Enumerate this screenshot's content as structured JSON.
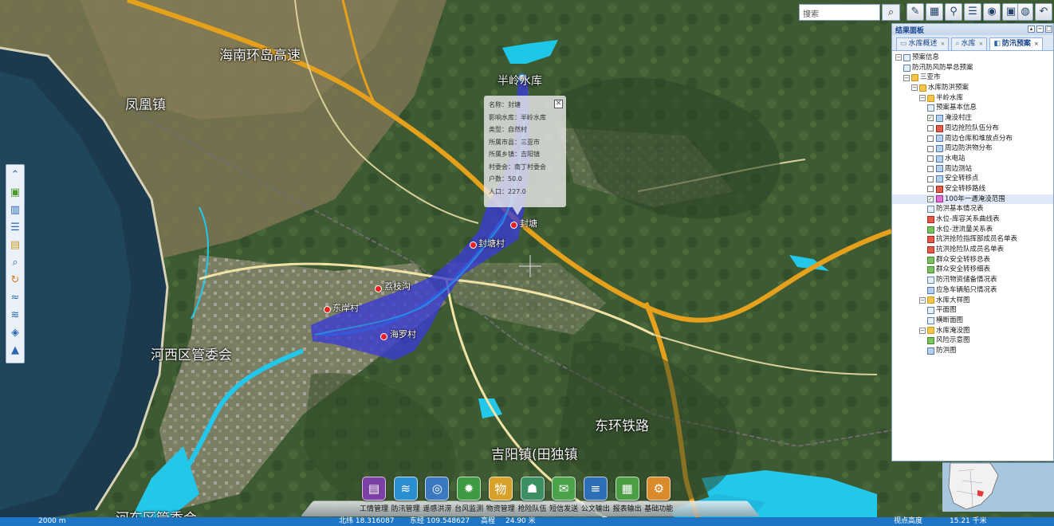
{
  "map": {
    "place_labels": [
      {
        "id": "hainan-ring",
        "text": "海南环岛高速"
      },
      {
        "id": "fenghuang",
        "text": "凤凰镇"
      },
      {
        "id": "banling-reservoir",
        "text": "半岭水库"
      },
      {
        "id": "hexi",
        "text": "河西区管委会"
      },
      {
        "id": "donghuan",
        "text": "东环铁路"
      },
      {
        "id": "jiyang",
        "text": "吉阳镇(田独镇"
      },
      {
        "id": "hedong",
        "text": "河东区管委会"
      }
    ],
    "villages": [
      {
        "id": "fengtang",
        "text": "封塘"
      },
      {
        "id": "fengtangcun",
        "text": "封塘村"
      },
      {
        "id": "lizhigou",
        "text": "荔枝沟"
      },
      {
        "id": "dongancun",
        "text": "东岸村"
      },
      {
        "id": "hailuocun",
        "text": "海罗村"
      }
    ],
    "flood_area_color": "#3a3ad6"
  },
  "popup": {
    "rows": [
      "名称：封塘",
      "影响水库：半岭水库",
      "类型：自然村",
      "所属市县：三亚市",
      "所属乡镇：吉阳镇",
      "村委会：南丁村委会",
      "户数：50.0",
      "人口：227.0"
    ],
    "close": "✕"
  },
  "toolbar": {
    "search_placeholder": "搜索",
    "search_icon": "magnifier-icon",
    "icons": [
      "edit-icon",
      "table-icon",
      "location-icon",
      "list-icon",
      "eye-icon",
      "image-icon",
      "globe-icon",
      "back-icon"
    ]
  },
  "panel": {
    "title": "结果面板",
    "tabs": [
      {
        "label": "水库概述",
        "active": false
      },
      {
        "label": "水库",
        "active": false
      },
      {
        "label": "防汛预案",
        "active": true
      }
    ],
    "tree": [
      {
        "label": "预案信息",
        "level": 0,
        "expander": "−",
        "icon": "doc"
      },
      {
        "label": "防汛防风防旱总预案",
        "level": 1,
        "icon": "doc"
      },
      {
        "label": "三亚市",
        "level": 1,
        "expander": "−",
        "icon": "folder"
      },
      {
        "label": "水库防洪预案",
        "level": 2,
        "expander": "−",
        "icon": "folder"
      },
      {
        "label": "半岭水库",
        "level": 3,
        "expander": "−",
        "icon": "folder"
      },
      {
        "label": "预案基本信息",
        "level": 4,
        "icon": "doc"
      },
      {
        "label": "淹没村庄",
        "level": 4,
        "icon": "layer",
        "check": true,
        "checked": true
      },
      {
        "label": "周边抢险队伍分布",
        "level": 4,
        "icon": "red",
        "check": true
      },
      {
        "label": "周边仓库和堆放点分布",
        "level": 4,
        "icon": "layer",
        "check": true
      },
      {
        "label": "周边防洪物分布",
        "level": 4,
        "icon": "layer",
        "check": true
      },
      {
        "label": "水电站",
        "level": 4,
        "icon": "layer",
        "check": true
      },
      {
        "label": "周边测站",
        "level": 4,
        "icon": "layer",
        "check": true
      },
      {
        "label": "安全转移点",
        "level": 4,
        "icon": "layer",
        "check": true
      },
      {
        "label": "安全转移路线",
        "level": 4,
        "icon": "red",
        "check": true
      },
      {
        "label": "100年一遇淹没范围",
        "level": 4,
        "icon": "pink",
        "check": true,
        "checked": true,
        "selected": true
      },
      {
        "label": "防洪基本情况表",
        "level": 4,
        "icon": "doc"
      },
      {
        "label": "水位-库容关系曲线表",
        "level": 4,
        "icon": "red"
      },
      {
        "label": "水位-泄流量关系表",
        "level": 4,
        "icon": "green"
      },
      {
        "label": "抗洪抢险指挥部成员名单表",
        "level": 4,
        "icon": "red"
      },
      {
        "label": "抗洪抢险队成员名单表",
        "level": 4,
        "icon": "red"
      },
      {
        "label": "群众安全转移总表",
        "level": 4,
        "icon": "green"
      },
      {
        "label": "群众安全转移细表",
        "level": 4,
        "icon": "green"
      },
      {
        "label": "防汛物资储备情况表",
        "level": 4,
        "icon": "doc"
      },
      {
        "label": "应急车辆船只情况表",
        "level": 4,
        "icon": "layer"
      },
      {
        "label": "水库大样图",
        "level": 3,
        "expander": "−",
        "icon": "folder"
      },
      {
        "label": "平面图",
        "level": 4,
        "icon": "doc"
      },
      {
        "label": "横断面图",
        "level": 4,
        "icon": "doc"
      },
      {
        "label": "水库淹没图",
        "level": 3,
        "expander": "−",
        "icon": "folder"
      },
      {
        "label": "风险示意图",
        "level": 4,
        "icon": "green"
      },
      {
        "label": "防洪图",
        "level": 4,
        "icon": "layer"
      }
    ]
  },
  "dock": [
    {
      "label": "工情管理",
      "icon": "monitor-icon",
      "color": "#7b3fa6",
      "glyph": "▤"
    },
    {
      "label": "防汛管理",
      "icon": "wave-icon",
      "color": "#2a8fd0",
      "glyph": "≋"
    },
    {
      "label": "遥感洪涝",
      "icon": "satellite-icon",
      "color": "#3a78c0",
      "glyph": "◎"
    },
    {
      "label": "台风监测",
      "icon": "typhoon-icon",
      "color": "#3f9a44",
      "glyph": "✹"
    },
    {
      "label": "物资管理",
      "icon": "goods-icon",
      "color": "#d7a12a",
      "glyph": "物"
    },
    {
      "label": "抢险队伍",
      "icon": "team-icon",
      "color": "#3b8f62",
      "glyph": "☗"
    },
    {
      "label": "短信发送",
      "icon": "mail-icon",
      "color": "#4aa24a",
      "glyph": "✉"
    },
    {
      "label": "公文输出",
      "icon": "document-icon",
      "color": "#2d6fb6",
      "glyph": "≡"
    },
    {
      "label": "报表输出",
      "icon": "report-icon",
      "color": "#4c9e45",
      "glyph": "▦"
    },
    {
      "label": "基础功能",
      "icon": "base-icon",
      "color": "#d98a2a",
      "glyph": "⚙"
    }
  ],
  "left_tools": [
    "collapse-icon",
    "layer-icon",
    "bookmark-icon",
    "identify-icon",
    "measure-icon",
    "zoom-icon",
    "refresh-icon",
    "water-icon",
    "flood-icon",
    "sea-icon",
    "wave-warning-icon"
  ],
  "status": {
    "scale": "2000 m",
    "lat": "北纬 18.316087",
    "lon": "东经 109.548627",
    "elev_label": "高程",
    "elev": "24.90 米",
    "view_label": "视点高度",
    "view": "15.21 千米"
  }
}
